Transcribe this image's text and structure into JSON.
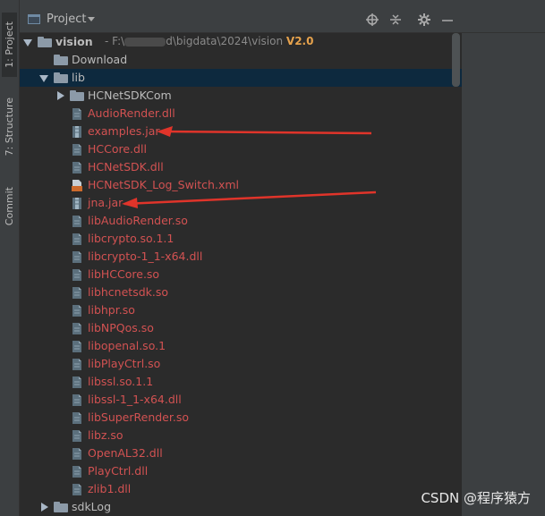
{
  "left_tabs": [
    {
      "label": "1: Project",
      "icon": "folder-icon"
    },
    {
      "label": "7: Structure",
      "icon": "structure-icon"
    },
    {
      "label": "Commit",
      "icon": "commit-icon"
    }
  ],
  "header": {
    "title": "Project",
    "buttons": [
      "locate-icon",
      "collapse-icon",
      "gear-icon",
      "minimize-icon"
    ]
  },
  "tree": [
    {
      "name": "vision",
      "type": "module",
      "expanded": true,
      "path": "F:\\",
      "path_suffix": "d\\bigdata\\2024\\vision",
      "version": "V2.0"
    },
    {
      "name": "Download",
      "type": "folder"
    },
    {
      "name": "lib",
      "type": "folder",
      "expanded": true,
      "selected": true
    },
    {
      "name": "HCNetSDKCom",
      "type": "folder",
      "expanded": false
    },
    {
      "name": "AudioRender.dll",
      "type": "dll"
    },
    {
      "name": "examples.jar",
      "type": "jar"
    },
    {
      "name": "HCCore.dll",
      "type": "dll"
    },
    {
      "name": "HCNetSDK.dll",
      "type": "dll"
    },
    {
      "name": "HCNetSDK_Log_Switch.xml",
      "type": "xml"
    },
    {
      "name": "jna.jar",
      "type": "jar"
    },
    {
      "name": "libAudioRender.so",
      "type": "so"
    },
    {
      "name": "libcrypto.so.1.1",
      "type": "so"
    },
    {
      "name": "libcrypto-1_1-x64.dll",
      "type": "dll"
    },
    {
      "name": "libHCCore.so",
      "type": "so"
    },
    {
      "name": "libhcnetsdk.so",
      "type": "so"
    },
    {
      "name": "libhpr.so",
      "type": "so"
    },
    {
      "name": "libNPQos.so",
      "type": "so"
    },
    {
      "name": "libopenal.so.1",
      "type": "so"
    },
    {
      "name": "libPlayCtrl.so",
      "type": "so"
    },
    {
      "name": "libssl.so.1.1",
      "type": "so"
    },
    {
      "name": "libssl-1_1-x64.dll",
      "type": "dll"
    },
    {
      "name": "libSuperRender.so",
      "type": "so"
    },
    {
      "name": "libz.so",
      "type": "so"
    },
    {
      "name": "OpenAL32.dll",
      "type": "dll"
    },
    {
      "name": "PlayCtrl.dll",
      "type": "dll"
    },
    {
      "name": "zlib1.dll",
      "type": "dll"
    },
    {
      "name": "sdkLog",
      "type": "folder",
      "expanded": false
    }
  ],
  "annotations": [
    "red-arrow-examples-jar",
    "red-arrow-jna-jar"
  ],
  "watermark": "CSDN @程序猿方",
  "colors": {
    "file_text": "#d25252",
    "selected_row": "#0d293e",
    "arrow": "#e0342a"
  }
}
